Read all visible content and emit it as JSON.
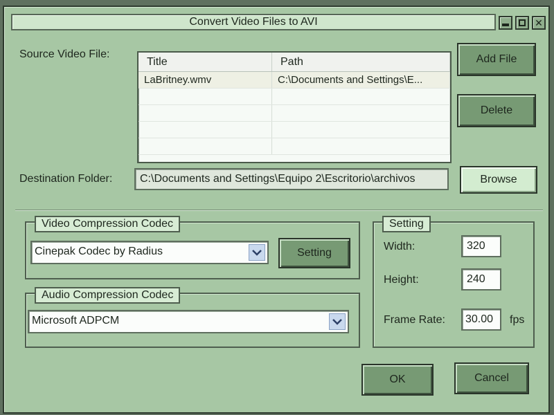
{
  "window": {
    "title": "Convert Video Files to AVI",
    "controls": {
      "minimize": "minimize-icon",
      "maximize": "maximize-icon",
      "close": "close-icon"
    }
  },
  "source": {
    "label": "Source Video File:",
    "columns": [
      "Title",
      "Path"
    ],
    "rows": [
      {
        "title": "LaBritney.wmv",
        "path": "C:\\Documents and Settings\\E..."
      },
      {
        "title": "",
        "path": ""
      },
      {
        "title": "",
        "path": ""
      },
      {
        "title": "",
        "path": ""
      },
      {
        "title": "",
        "path": ""
      }
    ],
    "add_file_label": "Add File",
    "delete_label": "Delete"
  },
  "destination": {
    "label": "Destination Folder:",
    "value": "C:\\Documents and Settings\\Equipo 2\\Escritorio\\archivos",
    "browse_label": "Browse"
  },
  "video_codec": {
    "group_title": "Video Compression Codec",
    "selected": "Cinepak Codec by Radius",
    "setting_label": "Setting"
  },
  "audio_codec": {
    "group_title": "Audio Compression Codec",
    "selected": "Microsoft ADPCM"
  },
  "setting": {
    "group_title": "Setting",
    "width_label": "Width:",
    "width_value": "320",
    "height_label": "Height:",
    "height_value": "240",
    "frame_rate_label": "Frame Rate:",
    "frame_rate_value": "30.00",
    "fps_unit": "fps"
  },
  "footer": {
    "ok_label": "OK",
    "cancel_label": "Cancel"
  },
  "colors": {
    "window_bg": "#a7c7a4",
    "button_dark": "#779a74",
    "button_light": "#d3ecd0",
    "title_bg": "#cfe6cc"
  }
}
